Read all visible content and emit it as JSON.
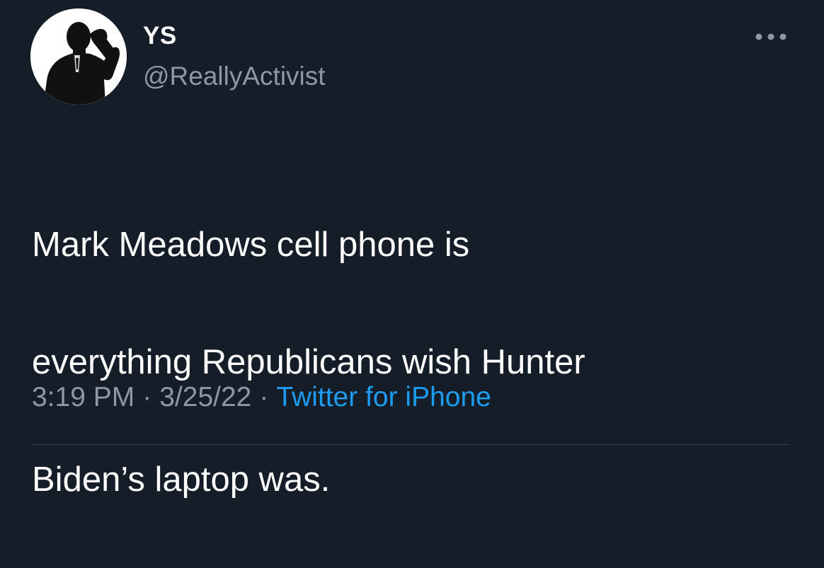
{
  "tweet": {
    "display_name": "YS",
    "handle": "@ReallyActivist",
    "text_lines": [
      "Mark Meadows cell phone is",
      "everything Republicans wish Hunter",
      "Biden’s laptop was."
    ],
    "time": "3:19 PM",
    "date": "3/25/22",
    "separator": "·",
    "source": "Twitter for iPhone"
  },
  "icons": {
    "avatar": "silhouette-man-on-phone-icon",
    "more": "more-horizontal-icon"
  },
  "colors": {
    "background": "#151d28",
    "primary_text": "#ffffff",
    "secondary_text": "#8b98a5",
    "link": "#1d9bf0",
    "divider": "#38444d"
  }
}
